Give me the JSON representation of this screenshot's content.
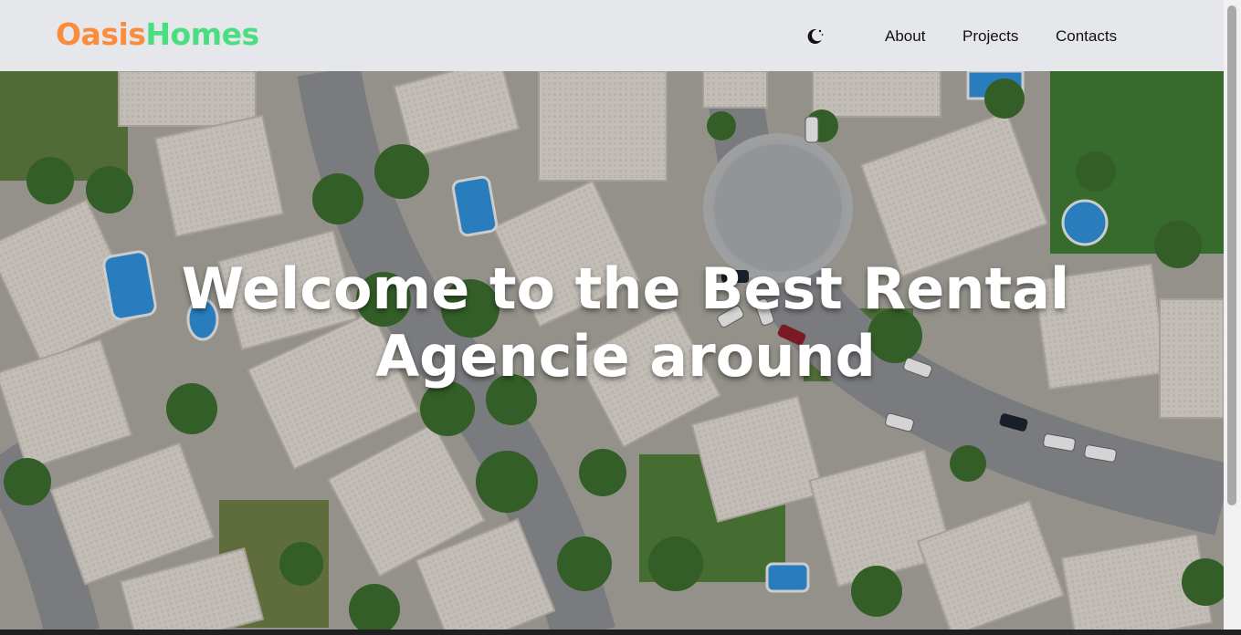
{
  "brand": {
    "part1": "Oasis",
    "part2": "Homes",
    "color1": "#fb8c3c",
    "color2": "#4ade80"
  },
  "header": {
    "background": "#e5e7eb",
    "theme_icon": "moon-icon"
  },
  "nav": {
    "items": [
      {
        "label": "About"
      },
      {
        "label": "Projects"
      },
      {
        "label": "Contacts"
      }
    ]
  },
  "hero": {
    "title": "Welcome to the Best Rental Agencie around",
    "background_image": "aerial-view-residential-neighborhood"
  }
}
